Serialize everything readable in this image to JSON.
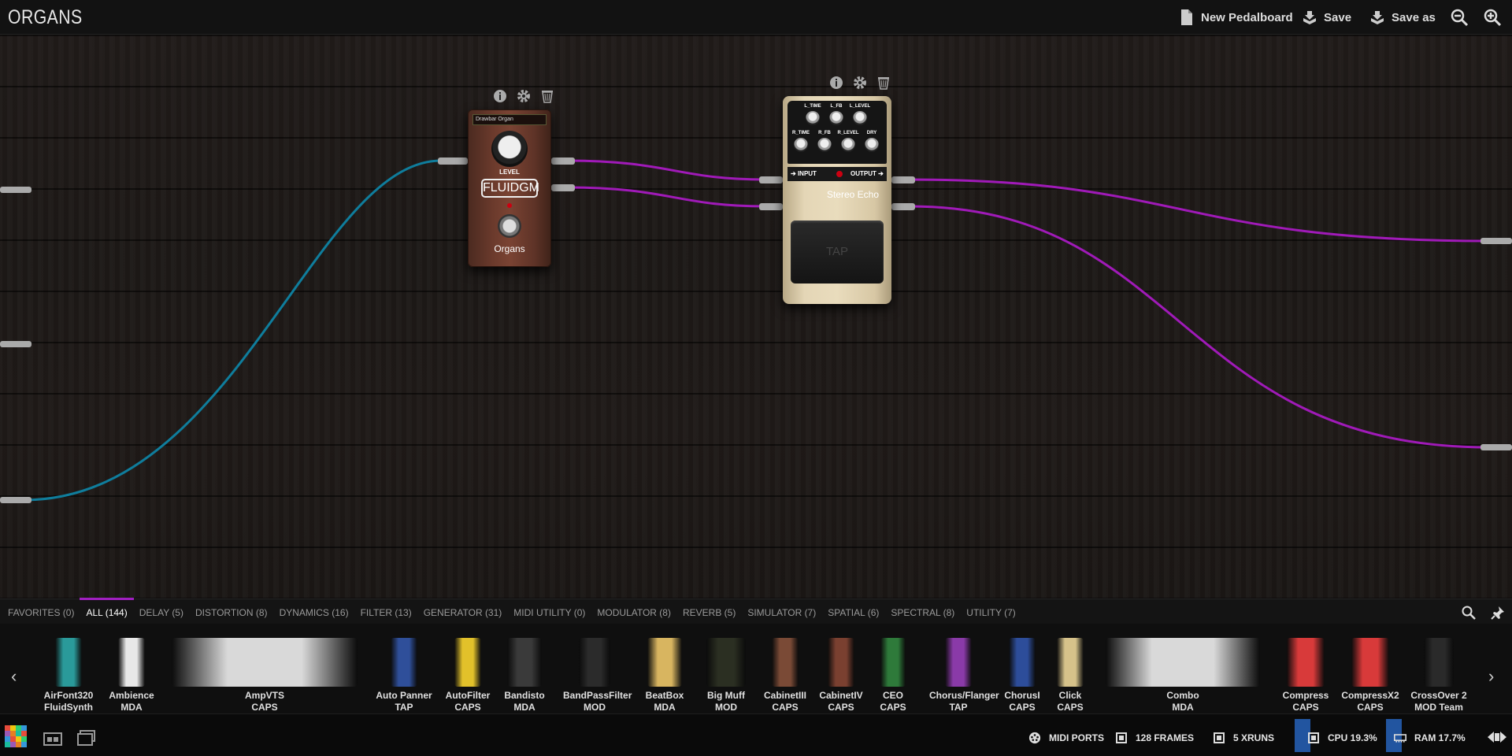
{
  "header": {
    "title": "ORGANS",
    "new_pedalboard": "New Pedalboard",
    "save": "Save",
    "save_as": "Save as"
  },
  "pedals": {
    "organ": {
      "preset": "Drawbar Organ",
      "knob_label": "LEVEL",
      "brand": "FLUIDGM",
      "name": "Organs"
    },
    "echo": {
      "knobs_top": [
        "L_TIME",
        "L_FB",
        "L_LEVEL"
      ],
      "knobs_bottom": [
        "R_TIME",
        "R_FB",
        "R_LEVEL",
        "DRY"
      ],
      "input": "INPUT",
      "output": "OUTPUT",
      "name": "Stereo Echo",
      "tap": "TAP"
    }
  },
  "categories": [
    {
      "label": "FAVORITES (0)"
    },
    {
      "label": "ALL (144)",
      "active": true
    },
    {
      "label": "DELAY (5)"
    },
    {
      "label": "DISTORTION (8)"
    },
    {
      "label": "DYNAMICS (16)"
    },
    {
      "label": "FILTER (13)"
    },
    {
      "label": "GENERATOR (31)"
    },
    {
      "label": "MIDI UTILITY (0)"
    },
    {
      "label": "MODULATOR (8)"
    },
    {
      "label": "REVERB (5)"
    },
    {
      "label": "SIMULATOR (7)"
    },
    {
      "label": "SPATIAL (6)"
    },
    {
      "label": "SPECTRAL (8)"
    },
    {
      "label": "UTILITY (7)"
    }
  ],
  "plugins": [
    {
      "name": "AirFont320",
      "brand": "FluidSynth",
      "color": "#2a9a9a"
    },
    {
      "name": "Ambience",
      "brand": "MDA",
      "color": "#e8e8e8"
    },
    {
      "name": "AmpVTS",
      "brand": "CAPS",
      "color": "#d9d9d9"
    },
    {
      "name": "Auto Panner",
      "brand": "TAP",
      "color": "#2f4f9a"
    },
    {
      "name": "AutoFilter",
      "brand": "CAPS",
      "color": "#e2c12a"
    },
    {
      "name": "Bandisto",
      "brand": "MDA",
      "color": "#3a3a3a"
    },
    {
      "name": "BandPassFilter",
      "brand": "MOD",
      "color": "#2b2b2b"
    },
    {
      "name": "BeatBox",
      "brand": "MDA",
      "color": "#d8b560"
    },
    {
      "name": "Big Muff",
      "brand": "MOD",
      "color": "#2b2f22"
    },
    {
      "name": "CabinetIII",
      "brand": "CAPS",
      "color": "#7a4a36"
    },
    {
      "name": "CabinetIV",
      "brand": "CAPS",
      "color": "#7a4030"
    },
    {
      "name": "CEO",
      "brand": "CAPS",
      "color": "#2e7a3a"
    },
    {
      "name": "Chorus/Flanger",
      "brand": "TAP",
      "color": "#8a3aa8"
    },
    {
      "name": "ChorusI",
      "brand": "CAPS",
      "color": "#2d4d9a"
    },
    {
      "name": "Click",
      "brand": "CAPS",
      "color": "#d6c28a"
    },
    {
      "name": "Combo",
      "brand": "MDA",
      "color": "#d9d9d9"
    },
    {
      "name": "Compress",
      "brand": "CAPS",
      "color": "#d83a3a"
    },
    {
      "name": "CompressX2",
      "brand": "CAPS",
      "color": "#d83a3a"
    },
    {
      "name": "CrossOver 2",
      "brand": "MOD Team",
      "color": "#2a2a2a"
    }
  ],
  "status": {
    "midi_ports": "MIDI PORTS",
    "frames": "128 FRAMES",
    "xruns": "5 XRUNS",
    "cpu": "CPU 19.3%",
    "ram": "RAM 17.7%"
  }
}
